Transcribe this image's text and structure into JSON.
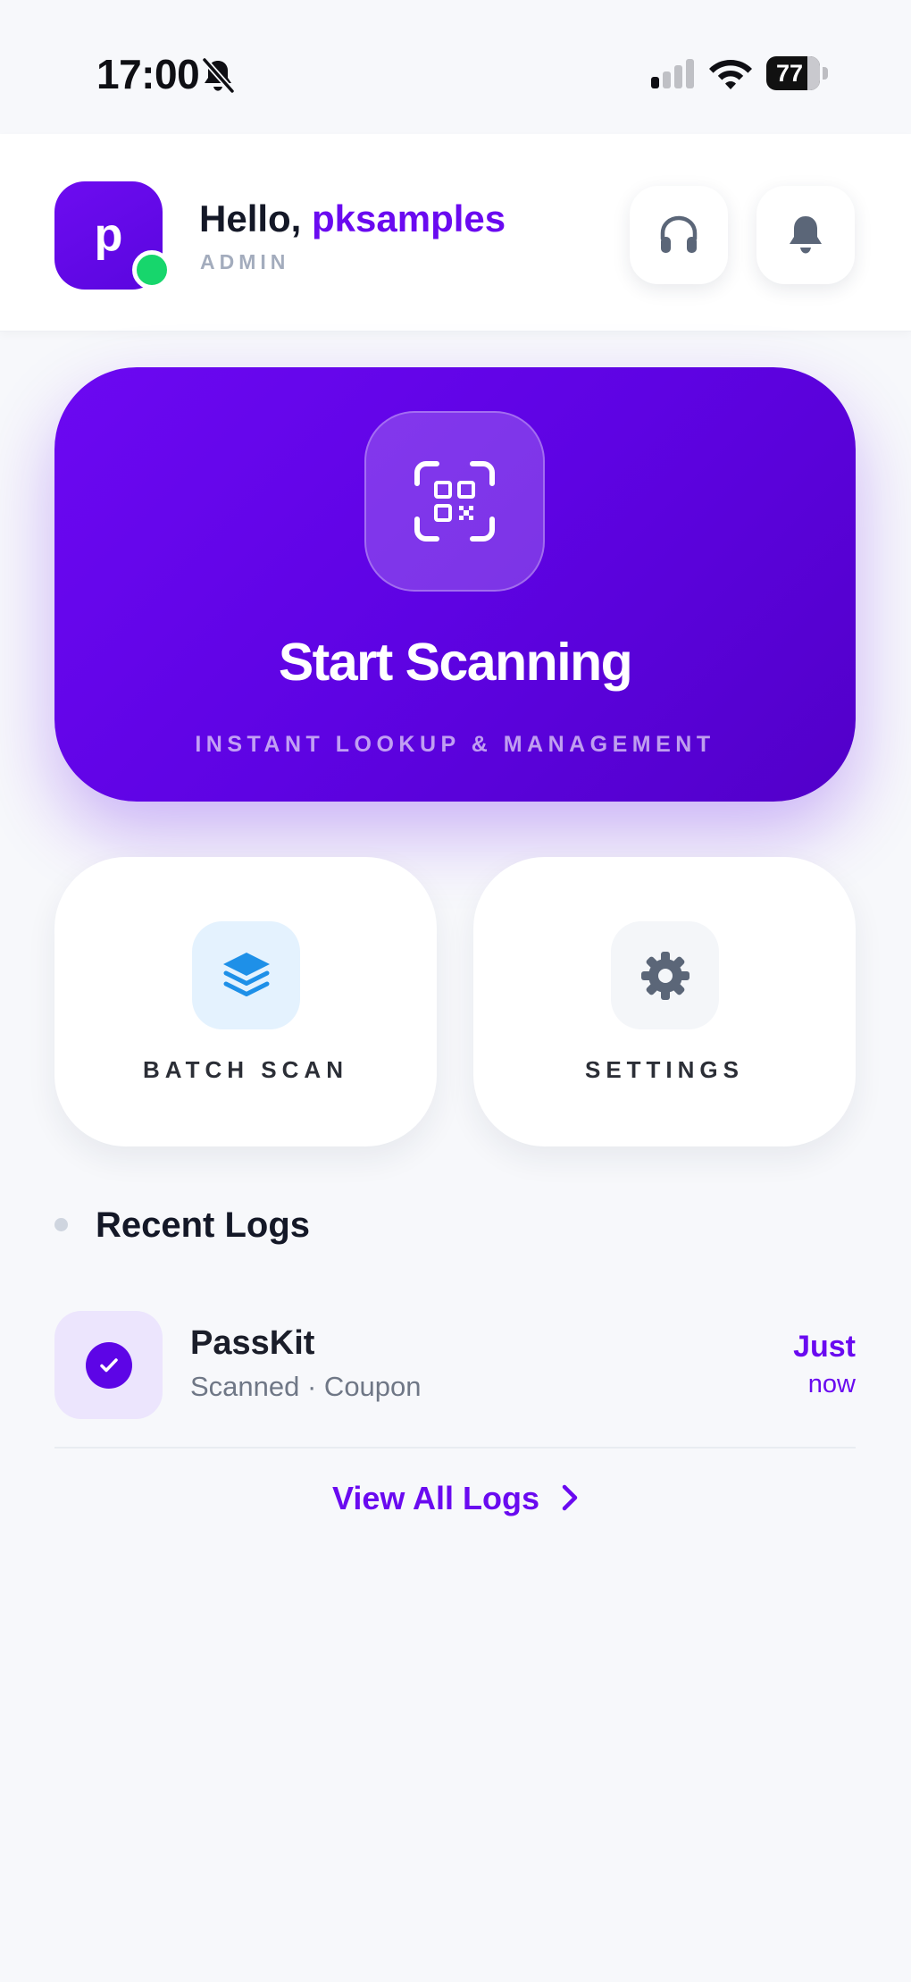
{
  "status_bar": {
    "time": "17:00",
    "battery": "77",
    "icons": [
      "bell-off-icon",
      "signal-icon",
      "wifi-icon",
      "battery-icon"
    ]
  },
  "header": {
    "avatar_letter": "p",
    "greeting_prefix": "Hello, ",
    "username": "pksamples",
    "role": "ADMIN",
    "online": true,
    "buttons": [
      "headphones-icon",
      "notification-bell-icon"
    ]
  },
  "scan_card": {
    "title": "Start Scanning",
    "subtitle": "INSTANT LOOKUP & MANAGEMENT",
    "icon": "qr-scan-icon"
  },
  "actions": [
    {
      "label": "BATCH SCAN",
      "icon": "layers-icon"
    },
    {
      "label": "SETTINGS",
      "icon": "gear-icon"
    }
  ],
  "recent_logs": {
    "title": "Recent Logs",
    "items": [
      {
        "title": "PassKit",
        "subtitle": "Scanned · Coupon",
        "time_line1": "Just",
        "time_line2": "now",
        "icon": "check-circle-icon"
      }
    ],
    "view_all_label": "View All Logs"
  },
  "colors": {
    "accent": "#6a0af0",
    "background": "#f7f8fb",
    "online": "#17d66c",
    "batch_icon": "#1e90e8",
    "settings_icon": "#5b6678"
  }
}
